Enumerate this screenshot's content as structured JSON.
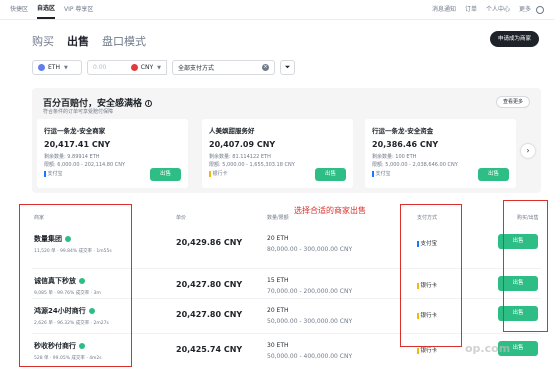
{
  "topnav": {
    "left": [
      "快捷区",
      "自选区",
      "VIP 尊享区"
    ],
    "right": [
      "消息通知",
      "订单",
      "个人中心",
      "更多"
    ]
  },
  "tabs": [
    "购买",
    "出售",
    "盘口模式"
  ],
  "apply_label": "申请成为商家",
  "filters": {
    "coin": "ETH",
    "amount_placeholder": "0.00",
    "currency": "CNY",
    "payment": "全部支付方式"
  },
  "promo": {
    "title": "百分百赔付，安全感满格",
    "subtitle": "符合条件的订单可享受赔付保障",
    "view_more": "查看更多",
    "cards": [
      {
        "title": "行运一条龙-安全商家",
        "price": "20,417.41 CNY",
        "remaining": "剩余数量: 9.89914 ETH",
        "limit": "限额: 6,000.00 - 202,114.80 CNY",
        "payment": "支付宝",
        "button": "出售"
      },
      {
        "title": "人美飒甜服务好",
        "price": "20,407.09 CNY",
        "remaining": "剩余数量: 81.114122 ETH",
        "limit": "限额: 5,000.00 - 1,655,303.18 CNY",
        "payment": "银行卡",
        "button": "出售"
      },
      {
        "title": "行运一条龙-安全资金",
        "price": "20,386.46 CNY",
        "remaining": "剩余数量: 100 ETH",
        "limit": "限额: 5,000.00 - 2,038,646.00 CNY",
        "payment": "支付宝",
        "button": "出售"
      }
    ]
  },
  "table": {
    "headers": [
      "商家",
      "单价",
      "数量/限额",
      "支付方式",
      "购买/出售"
    ],
    "rows": [
      {
        "name": "数量集团",
        "meta": "11,520 单  ·  99.84% 成交率  ·  1m55s",
        "price": "20,429.86 CNY",
        "amount": "20 ETH",
        "limit": "80,000.00 - 300,000.00 CNY",
        "payment": "支付宝",
        "pay_color": "#1677ff",
        "button": "出售"
      },
      {
        "name": "诚信真下秒放",
        "meta": "9,085 单  ·  99.76% 成交率  ·  3m",
        "price": "20,427.80 CNY",
        "amount": "15 ETH",
        "limit": "70,000.00 - 200,000.00 CNY",
        "payment": "银行卡",
        "pay_color": "#f0b90b",
        "button": "出售"
      },
      {
        "name": "鸿源24小时商行",
        "meta": "2,626 单  ·  96.32% 成交率  ·  2m27s",
        "price": "20,427.80 CNY",
        "amount": "20 ETH",
        "limit": "50,000.00 - 300,000.00 CNY",
        "payment": "银行卡",
        "pay_color": "#f0b90b",
        "button": "出售"
      },
      {
        "name": "秒收秒付商行",
        "meta": "528 单  ·  99.05% 成交率  ·  4m2s",
        "price": "20,425.74 CNY",
        "amount": "30 ETH",
        "limit": "50,000.00 - 400,000.00 CNY",
        "payment": "银行卡",
        "pay_color": "#f0b90b",
        "button": "出售"
      }
    ]
  },
  "annotation_label": "选择合适的商家出售",
  "watermark": "op.com",
  "colors": {
    "green": "#2ebd85",
    "annotation_red": "#d9302c",
    "eth_blue": "#627eea",
    "cny_red": "#e33b3b"
  }
}
